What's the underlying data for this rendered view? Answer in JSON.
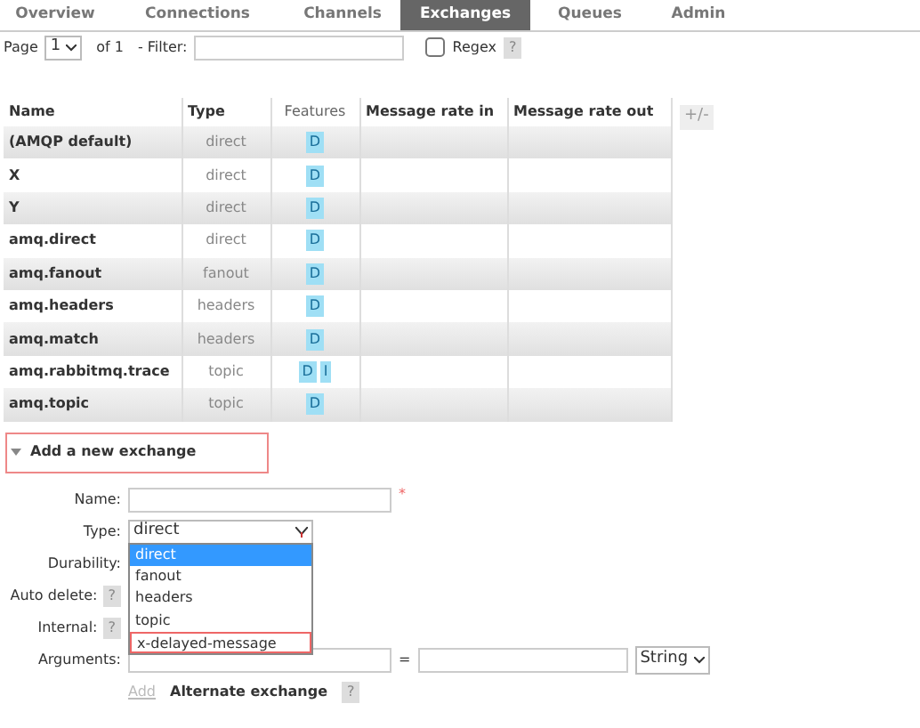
{
  "tabs": [
    {
      "label": "Overview",
      "selected": false
    },
    {
      "label": "Connections",
      "selected": false
    },
    {
      "label": "Channels",
      "selected": false
    },
    {
      "label": "Exchanges",
      "selected": true
    },
    {
      "label": "Queues",
      "selected": false
    },
    {
      "label": "Admin",
      "selected": false
    }
  ],
  "pager": {
    "page_label": "Page",
    "page": "1",
    "of": "of 1",
    "filter_label": "- Filter:",
    "regex_label": "Regex",
    "regex_checked": false,
    "help": "?"
  },
  "table": {
    "columns": [
      "Name",
      "Type",
      "Features",
      "Message rate in",
      "Message rate out"
    ],
    "toggle": "+/-",
    "rows": [
      {
        "name": "(AMQP default)",
        "type": "direct",
        "features": [
          "D"
        ]
      },
      {
        "name": "X",
        "type": "direct",
        "features": [
          "D"
        ]
      },
      {
        "name": "Y",
        "type": "direct",
        "features": [
          "D"
        ]
      },
      {
        "name": "amq.direct",
        "type": "direct",
        "features": [
          "D"
        ]
      },
      {
        "name": "amq.fanout",
        "type": "fanout",
        "features": [
          "D"
        ]
      },
      {
        "name": "amq.headers",
        "type": "headers",
        "features": [
          "D"
        ]
      },
      {
        "name": "amq.match",
        "type": "headers",
        "features": [
          "D"
        ]
      },
      {
        "name": "amq.rabbitmq.trace",
        "type": "topic",
        "features": [
          "D",
          "I"
        ]
      },
      {
        "name": "amq.topic",
        "type": "topic",
        "features": [
          "D"
        ]
      }
    ]
  },
  "add_section": {
    "title": "Add a new exchange",
    "expanded": true,
    "outlined": true,
    "name_label": "Name:",
    "required_mark": "*",
    "type_label": "Type:",
    "type_value": "direct",
    "type_options": [
      {
        "label": "direct",
        "selected": true,
        "outlined": false
      },
      {
        "label": "fanout",
        "selected": false,
        "outlined": false
      },
      {
        "label": "headers",
        "selected": false,
        "outlined": false
      },
      {
        "label": "topic",
        "selected": false,
        "outlined": false
      },
      {
        "label": "x-delayed-message",
        "selected": false,
        "outlined": true
      }
    ],
    "durability_label": "Durability:",
    "auto_delete_label": "Auto delete:",
    "internal_label": "Internal:",
    "help": "?",
    "arguments_label": "Arguments:",
    "equals": "=",
    "arg_type": "String",
    "add_link": "Add",
    "alternate_label": "Alternate exchange"
  }
}
